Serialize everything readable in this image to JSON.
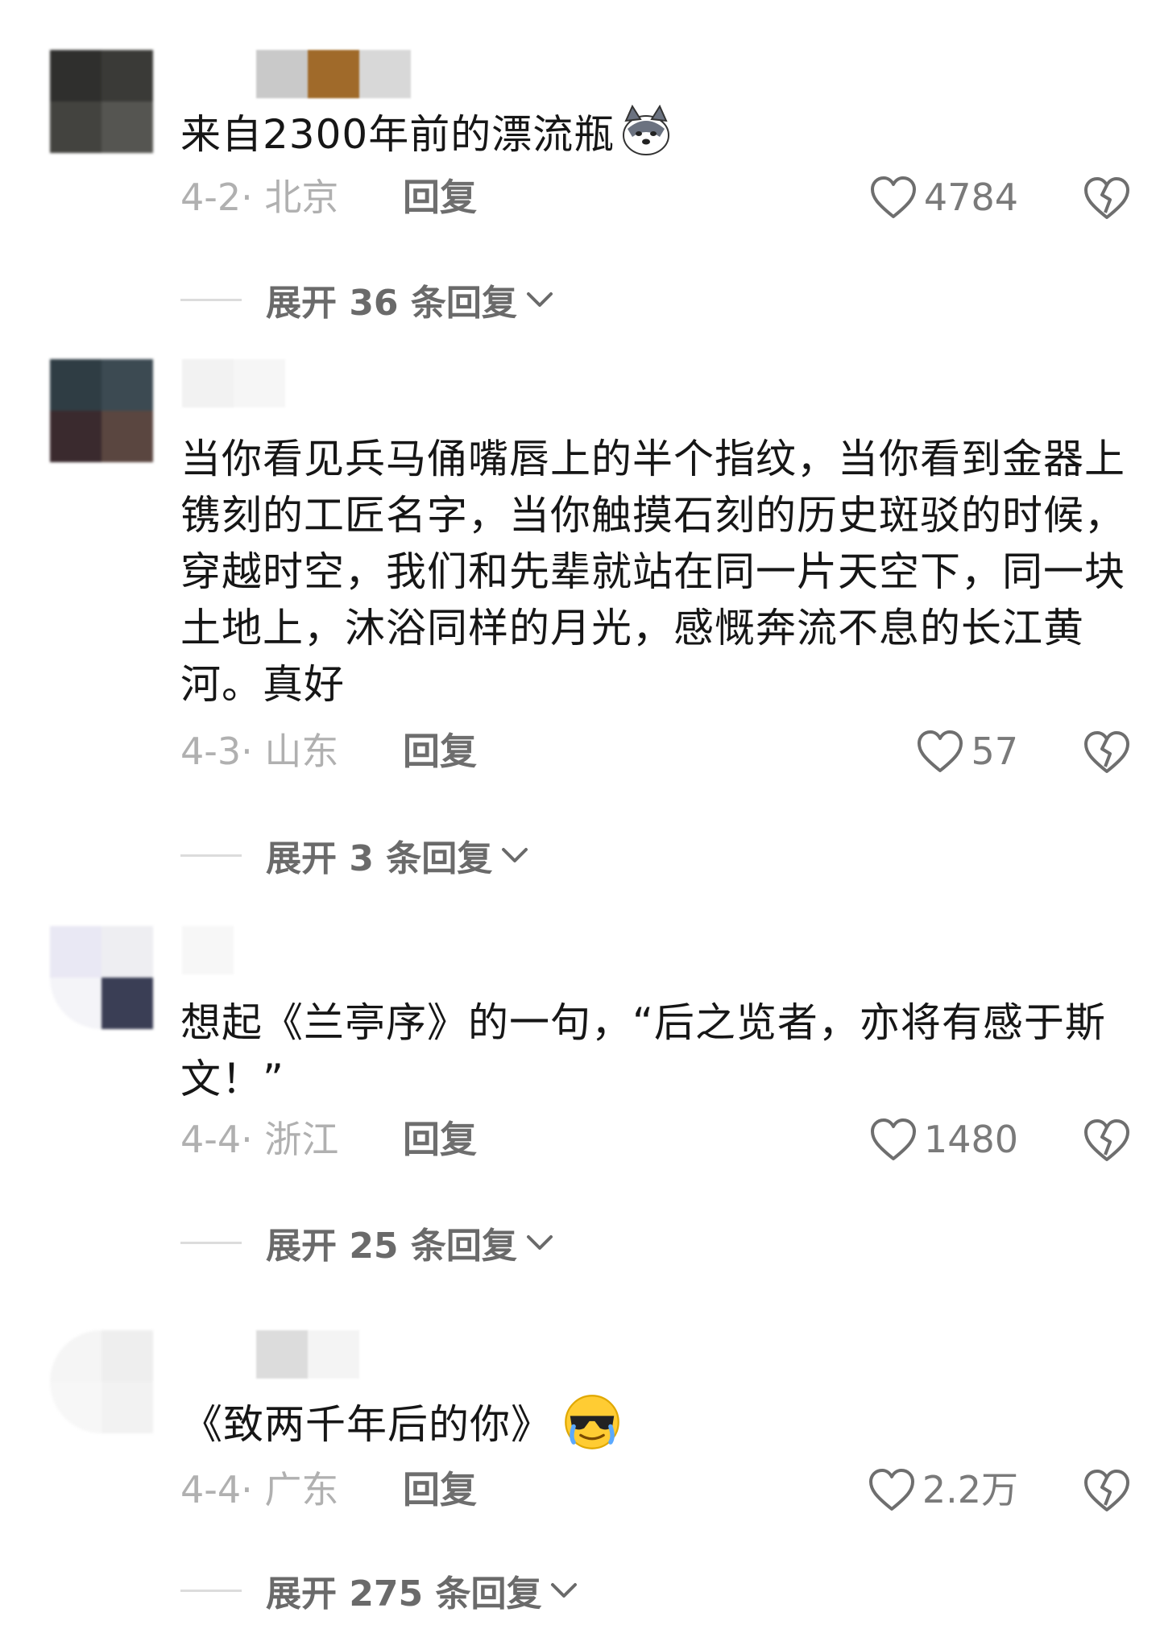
{
  "comments": [
    {
      "text": "来自2300年前的漂流瓶",
      "emoji": "husky-dog-emoji",
      "date_location": "4-2· 北京",
      "reply_label": "回复",
      "likes": "4784",
      "expand_label": "展开 36 条回复"
    },
    {
      "text": "当你看见兵马俑嘴唇上的半个指纹，当你看到金器上镌刻的工匠名字，当你触摸石刻的历史斑驳的时候，穿越时空，我们和先辈就站在同一片天空下，同一块土地上，沐浴同样的月光，感慨奔流不息的长江黄河。真好",
      "emoji": "",
      "date_location": "4-3· 山东",
      "reply_label": "回复",
      "likes": "57",
      "expand_label": "展开 3 条回复"
    },
    {
      "text": "想起《兰亭序》的一句，“后之览者，亦将有感于斯文！”",
      "emoji": "",
      "date_location": "4-4· 浙江",
      "reply_label": "回复",
      "likes": "1480",
      "expand_label": "展开 25 条回复"
    },
    {
      "text": "《致两千年后的你》",
      "emoji": "cool-sunglasses-crying-emoji",
      "date_location": "4-4· 广东",
      "reply_label": "回复",
      "likes": "2.2万",
      "expand_label": "展开 275 条回复"
    }
  ],
  "icons": {
    "like": "heart-outline-icon",
    "dislike": "broken-heart-icon",
    "expand": "chevron-down-icon"
  },
  "colors": {
    "text": "#161616",
    "meta": "#b0b0b0",
    "reply": "#6e6e6e",
    "expand": "#6a6a6a"
  }
}
